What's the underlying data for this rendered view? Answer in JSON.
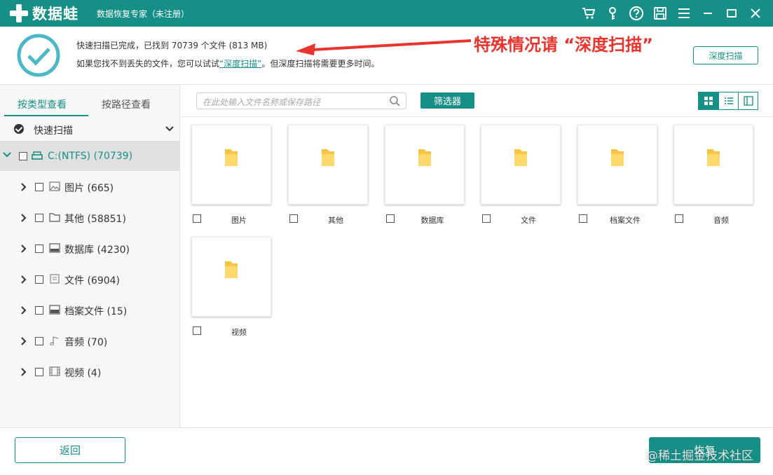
{
  "app": {
    "logo_text": "数据蛙",
    "window_title": "数据恢复专家（未注册）"
  },
  "titlebar_icons": [
    "cart-icon",
    "key-icon",
    "help-icon",
    "save-icon",
    "menu-icon",
    "minimize-icon",
    "close-icon"
  ],
  "status": {
    "line1": "快速扫描已完成，已找到 70739 个文件 (813 MB)",
    "line2_prefix": "如果您找不到丢失的文件，您可以试试",
    "line2_link": "“深度扫描”",
    "line2_suffix": "。但深度扫描将需要更多时间。",
    "annotation": "特殊情况请 “深度扫描”",
    "deep_scan_button": "深度扫描"
  },
  "sidebar": {
    "tabs": [
      "按类型查看",
      "按路径查看"
    ],
    "quick_scan_label": "快速扫描",
    "drive_label": "C:(NTFS) (70739)",
    "items": [
      {
        "label": "图片 (665)",
        "icon": "image-icon"
      },
      {
        "label": "其他 (58851)",
        "icon": "folder-icon"
      },
      {
        "label": "数据库 (4230)",
        "icon": "database-icon"
      },
      {
        "label": "文件 (6904)",
        "icon": "document-icon"
      },
      {
        "label": "档案文件 (15)",
        "icon": "archive-icon"
      },
      {
        "label": "音频 (70)",
        "icon": "audio-icon"
      },
      {
        "label": "视频 (4)",
        "icon": "video-icon"
      }
    ]
  },
  "toolbar": {
    "search_placeholder": "在此处输入文件名称或保存路径",
    "filter_button": "筛选器",
    "views": [
      "grid-view-icon",
      "list-view-icon",
      "detail-view-icon"
    ],
    "active_view": "grid-view-icon"
  },
  "grid": {
    "tiles": [
      "图片",
      "其他",
      "数据库",
      "文件",
      "档案文件",
      "音频",
      "视频"
    ]
  },
  "footer": {
    "back_button": "返回",
    "recover_button": "恢复",
    "watermark": "@稀土掘金技术社区"
  },
  "colors": {
    "accent": "#168f86",
    "annotation_red": "#e8342d",
    "folder_yellow": "#f5c542"
  }
}
